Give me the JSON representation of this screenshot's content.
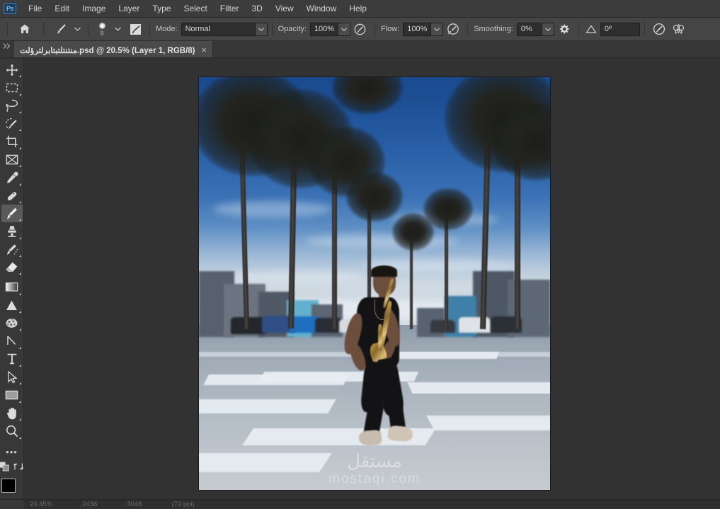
{
  "app": {
    "logo": "Ps",
    "name": "Adobe Photoshop"
  },
  "menubar": {
    "items": [
      {
        "label": "File"
      },
      {
        "label": "Edit"
      },
      {
        "label": "Image"
      },
      {
        "label": "Layer"
      },
      {
        "label": "Type"
      },
      {
        "label": "Select"
      },
      {
        "label": "Filter"
      },
      {
        "label": "3D"
      },
      {
        "label": "View"
      },
      {
        "label": "Window"
      },
      {
        "label": "Help"
      }
    ]
  },
  "options_bar": {
    "home_icon": "home-icon",
    "brush_preset_icon": "brush-icon",
    "brush_size": "9",
    "toggle_brush_panel_icon": "brush-panel-icon",
    "mode_label": "Mode:",
    "mode_value": "Normal",
    "opacity_label": "Opacity:",
    "opacity_value": "100%",
    "opacity_pressure_icon": "pressure-opacity-icon",
    "flow_label": "Flow:",
    "flow_value": "100%",
    "airbrush_icon": "airbrush-icon",
    "smoothing_label": "Smoothing:",
    "smoothing_value": "0%",
    "smoothing_options_icon": "gear-icon",
    "angle_icon": "angle-icon",
    "angle_value": "0º",
    "pressure_size_icon": "pressure-size-icon",
    "symmetry_icon": "symmetry-butterfly-icon"
  },
  "tabbar": {
    "collapse_icon": "double-chevron-right-icon",
    "document": {
      "title": "منتنتلتبتابرلترؤلت.psd @ 20.5% (Layer 1, RGB/8)",
      "close_icon": "×"
    }
  },
  "toolbar": {
    "tools": [
      {
        "name": "move-tool",
        "title": "Move Tool",
        "active": false
      },
      {
        "name": "rectangular-marquee-tool",
        "title": "Rectangular Marquee Tool",
        "active": false
      },
      {
        "name": "lasso-tool",
        "title": "Lasso Tool",
        "active": false
      },
      {
        "name": "quick-selection-tool",
        "title": "Object Selection Tool",
        "active": false
      },
      {
        "name": "crop-tool",
        "title": "Crop Tool",
        "active": false
      },
      {
        "name": "frame-tool",
        "title": "Frame Tool",
        "active": false
      },
      {
        "name": "eyedropper-tool",
        "title": "Eyedropper Tool",
        "active": false
      },
      {
        "name": "spot-healing-brush-tool",
        "title": "Spot Healing Brush Tool",
        "active": false
      },
      {
        "name": "brush-tool",
        "title": "Brush Tool",
        "active": true
      },
      {
        "name": "clone-stamp-tool",
        "title": "Clone Stamp Tool",
        "active": false
      },
      {
        "name": "history-brush-tool",
        "title": "History Brush Tool",
        "active": false
      },
      {
        "name": "eraser-tool",
        "title": "Eraser Tool",
        "active": false
      },
      {
        "name": "gradient-tool",
        "title": "Gradient Tool",
        "active": false
      },
      {
        "name": "blur-tool",
        "title": "Blur Tool",
        "active": false
      },
      {
        "name": "dodge-tool",
        "title": "Dodge Tool",
        "active": false
      },
      {
        "name": "pen-tool",
        "title": "Pen Tool",
        "active": false
      },
      {
        "name": "horizontal-type-tool",
        "title": "Horizontal Type Tool",
        "active": false
      },
      {
        "name": "path-selection-tool",
        "title": "Path Selection Tool",
        "active": false
      },
      {
        "name": "rectangle-tool",
        "title": "Rectangle Tool",
        "active": false
      },
      {
        "name": "hand-tool",
        "title": "Hand Tool",
        "active": false
      },
      {
        "name": "zoom-tool",
        "title": "Zoom Tool",
        "active": false
      }
    ],
    "more_tools": "•••",
    "quick_mask_icon": "quick-mask-icon",
    "screen_mode_icon": "screen-mode-icon",
    "foreground_color": "#000000",
    "background_color": "#ffffff"
  },
  "canvas": {
    "zoom_level": "20.5%",
    "layer_name": "Layer 1",
    "color_mode": "RGB/8",
    "watermark_arabic": "مستقل",
    "watermark_latin": "mostaqi.com",
    "image_description": "Saxophone player on a palm-lined street crosswalk"
  },
  "statusbar": {
    "zoom": "20.45%",
    "width": "2436",
    "height": "3048",
    "channel_info": "(72 ppi)"
  },
  "colors": {
    "menu_bg": "#3c3c3c",
    "options_bg": "#454545",
    "panel_bg": "#383838",
    "canvas_bg": "#323232",
    "text": "#d4d4d4",
    "accent": "#4a7fb5"
  }
}
